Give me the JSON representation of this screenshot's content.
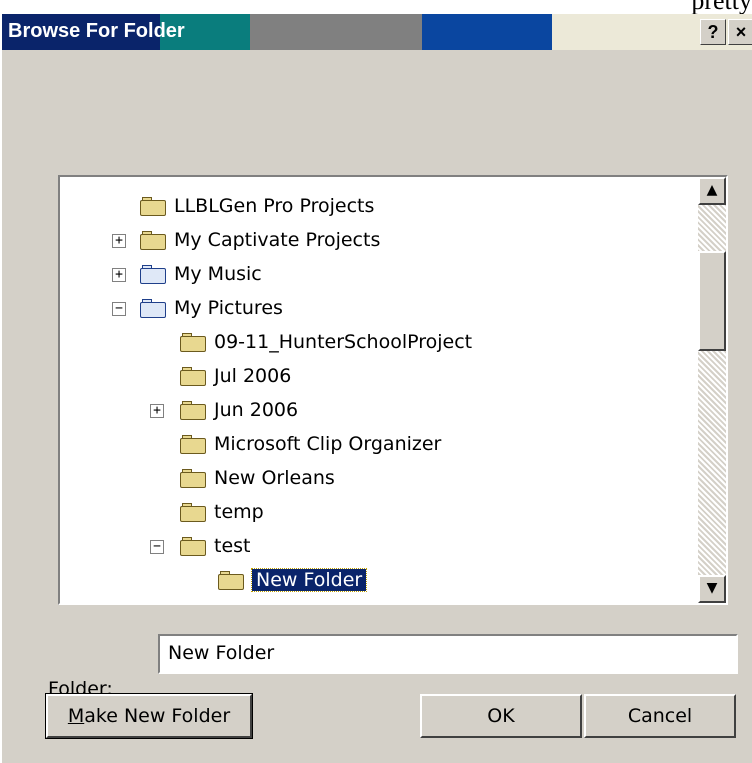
{
  "background_text": "pretty",
  "dialog": {
    "title": "Browse For Folder",
    "help_button": "?",
    "close_button": "×"
  },
  "tree": {
    "items": [
      {
        "label": "LLBLGen Pro Projects"
      },
      {
        "label": "My Captivate Projects",
        "expander": "+"
      },
      {
        "label": "My Music",
        "expander": "+"
      },
      {
        "label": "My Pictures",
        "expander": "−"
      },
      {
        "label": "09-11_HunterSchoolProject"
      },
      {
        "label": "Jul 2006"
      },
      {
        "label": "Jun 2006",
        "expander": "+"
      },
      {
        "label": "Microsoft Clip Organizer"
      },
      {
        "label": "New Orleans"
      },
      {
        "label": "temp"
      },
      {
        "label": "test",
        "expander": "−"
      },
      {
        "label": "New Folder",
        "selected": true
      }
    ],
    "scroll_up": "▲",
    "scroll_down": "▼"
  },
  "folder_field": {
    "label": "Folder:",
    "value": "New Folder"
  },
  "buttons": {
    "make_new_folder_mnemonic": "M",
    "make_new_folder_rest": "ake New Folder",
    "ok": "OK",
    "cancel": "Cancel"
  },
  "colors": {
    "titlebar": "#0a246a",
    "selection": "#0a246a",
    "dialog_face": "#d4d0c8"
  }
}
